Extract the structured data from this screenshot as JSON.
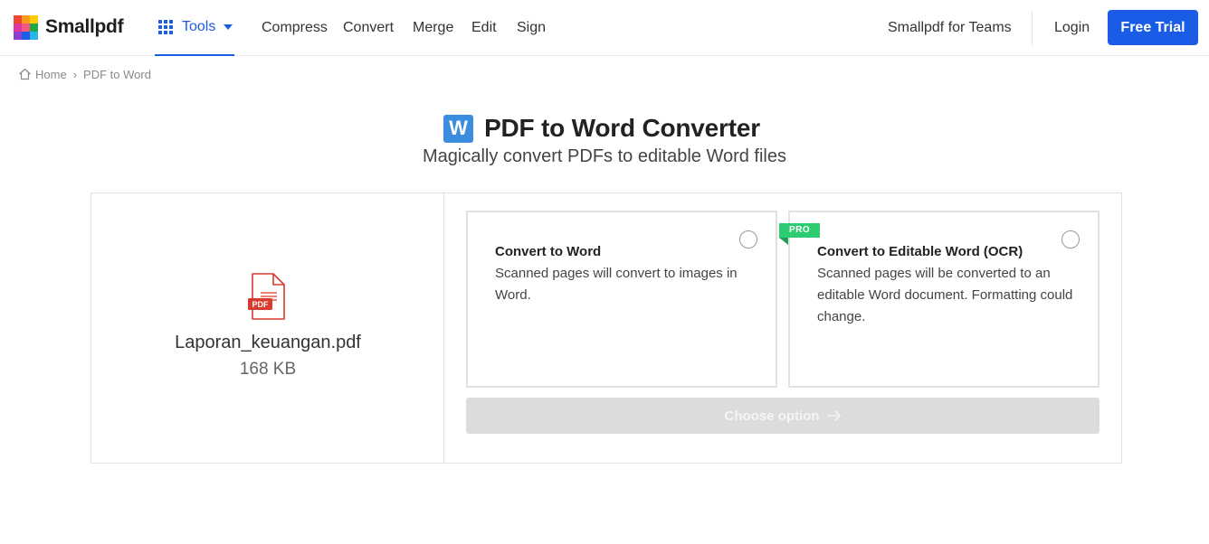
{
  "header": {
    "brand": "Smallpdf",
    "logo_colors": [
      "#f0452f",
      "#f79b1f",
      "#ffcb05",
      "#1fa74a",
      "#2ab5e6",
      "#1a5ce6",
      "#8a3fd1",
      "#e0359c",
      "#f05a7e"
    ],
    "tools_label": "Tools",
    "nav": [
      "Compress",
      "Convert",
      "Merge",
      "Edit",
      "Sign"
    ],
    "teams_label": "Smallpdf for Teams",
    "login_label": "Login",
    "trial_label": "Free Trial",
    "accent_color": "#1a5ce6"
  },
  "breadcrumb": {
    "home": "Home",
    "separator": "›",
    "current": "PDF to Word"
  },
  "hero": {
    "badge_letter": "W",
    "title": "PDF to Word Converter",
    "subtitle": "Magically convert PDFs to editable Word files"
  },
  "file": {
    "icon_label": "PDF",
    "name": "Laporan_keuangan.pdf",
    "size": "168 KB"
  },
  "options": [
    {
      "title": "Convert to Word",
      "description": "Scanned pages will convert to images in Word.",
      "selected": false
    },
    {
      "badge": "PRO",
      "title": "Convert to Editable Word (OCR)",
      "description": "Scanned pages will be converted to an editable Word document. Formatting could change.",
      "selected": false
    }
  ],
  "action": {
    "label": "Choose option",
    "enabled": false
  }
}
